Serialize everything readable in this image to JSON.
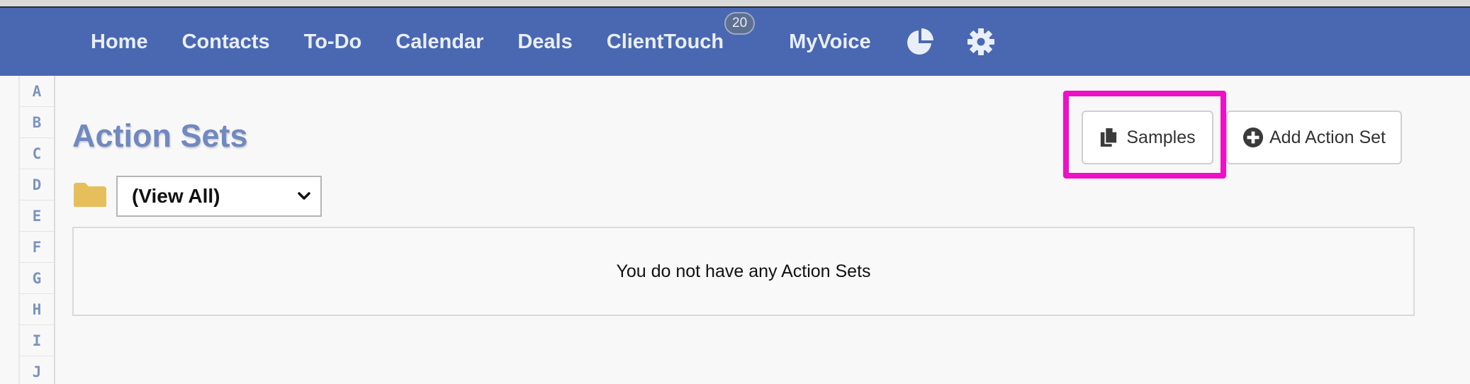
{
  "nav": {
    "items": [
      {
        "label": "Home"
      },
      {
        "label": "Contacts"
      },
      {
        "label": "To-Do"
      },
      {
        "label": "Calendar"
      },
      {
        "label": "Deals"
      },
      {
        "label": "ClientTouch",
        "badge": "20"
      },
      {
        "label": "MyVoice"
      }
    ],
    "icons": [
      "pie-chart-icon",
      "gear-icon"
    ],
    "bg_color": "#4a68b1"
  },
  "letters": [
    "A",
    "B",
    "C",
    "D",
    "E",
    "F",
    "G",
    "H",
    "I",
    "J"
  ],
  "page": {
    "title": "Action Sets",
    "folder_select": {
      "selected": "(View All)"
    },
    "samples_button": "Samples",
    "add_button": "Add Action Set",
    "empty_message": "You do not have any Action Sets",
    "highlight_color": "#ee10c6"
  }
}
